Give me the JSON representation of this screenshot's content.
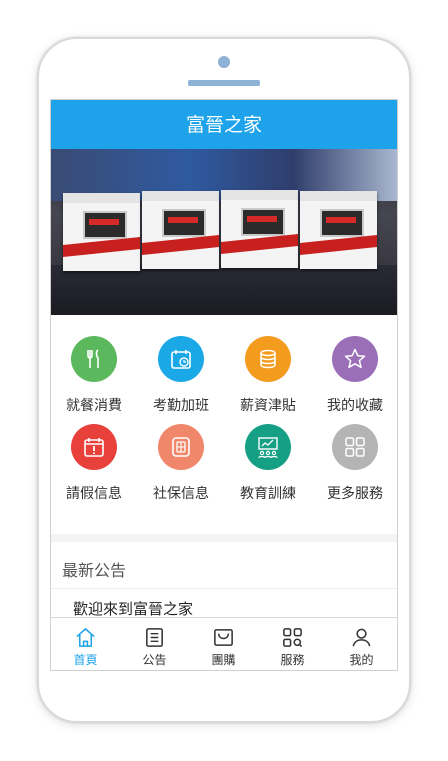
{
  "app": {
    "title": "富晉之家"
  },
  "menu": [
    {
      "label": "就餐消費",
      "icon": "utensils-icon",
      "color": "#5cb85c"
    },
    {
      "label": "考勤加班",
      "icon": "calendar-clock-icon",
      "color": "#1aa9e6"
    },
    {
      "label": "薪資津貼",
      "icon": "coins-icon",
      "color": "#f29b1d"
    },
    {
      "label": "我的收藏",
      "icon": "star-icon",
      "color": "#9b6fb8"
    },
    {
      "label": "請假信息",
      "icon": "calendar-alert-icon",
      "color": "#e8403b"
    },
    {
      "label": "社保信息",
      "icon": "card-icon",
      "color": "#f0876b"
    },
    {
      "label": "教育訓練",
      "icon": "training-icon",
      "color": "#15a085"
    },
    {
      "label": "更多服務",
      "icon": "grid-icon",
      "color": "#b4b4b4"
    }
  ],
  "notice": {
    "title": "最新公告",
    "items": [
      "歡迎來到富晉之家"
    ]
  },
  "tabs": [
    {
      "label": "首頁",
      "icon": "home-icon",
      "active": true
    },
    {
      "label": "公告",
      "icon": "notice-icon",
      "active": false
    },
    {
      "label": "團購",
      "icon": "cart-icon",
      "active": false
    },
    {
      "label": "服務",
      "icon": "service-icon",
      "active": false
    },
    {
      "label": "我的",
      "icon": "user-icon",
      "active": false
    }
  ],
  "colors": {
    "primary": "#1ea2ea"
  }
}
